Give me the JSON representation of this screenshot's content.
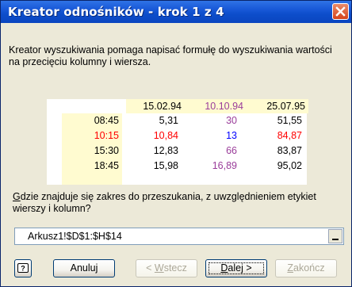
{
  "window": {
    "title": "Kreator odnośników - krok 1 z 4"
  },
  "intro_text": "Kreator wyszukiwania pomaga napisać formułę do wyszukiwania wartości na przecięciu kolumny i wiersza.",
  "preview": {
    "column_headers": [
      {
        "text": "15.02.94",
        "color": "#000000"
      },
      {
        "text": "10.10.94",
        "color": "#9a3d9a"
      },
      {
        "text": "25.07.95",
        "color": "#000000"
      }
    ],
    "rows": [
      {
        "label": "08:45",
        "label_color": "#000000",
        "values": [
          {
            "text": "5,31",
            "color": "#000000"
          },
          {
            "text": "30",
            "color": "#9a3d9a"
          },
          {
            "text": "51,55",
            "color": "#000000"
          }
        ]
      },
      {
        "label": "10:15",
        "label_color": "#ff0000",
        "values": [
          {
            "text": "10,84",
            "color": "#ff0000"
          },
          {
            "text": "13",
            "color": "#0000ff"
          },
          {
            "text": "84,87",
            "color": "#ff0000"
          }
        ]
      },
      {
        "label": "15:30",
        "label_color": "#000000",
        "values": [
          {
            "text": "12,83",
            "color": "#000000"
          },
          {
            "text": "66",
            "color": "#9a3d9a"
          },
          {
            "text": "83,87",
            "color": "#000000"
          }
        ]
      },
      {
        "label": "18:45",
        "label_color": "#000000",
        "values": [
          {
            "text": "15,98",
            "color": "#000000"
          },
          {
            "text": "16,89",
            "color": "#9a3d9a"
          },
          {
            "text": "95,02",
            "color": "#000000"
          }
        ]
      }
    ]
  },
  "question": {
    "first_letter": "G",
    "rest": "dzie znajduje się zakres do przeszukania, z uwzględnieniem etykiet wierszy i kolumn?"
  },
  "range_input": {
    "value": "Arkusz1!$D$1:$H$14"
  },
  "buttons": {
    "help": {
      "icon": "help-icon"
    },
    "cancel": {
      "label": "Anuluj"
    },
    "back": {
      "prefix": "< ",
      "accel": "W",
      "rest": "stecz"
    },
    "next": {
      "accel": "D",
      "rest": "alej >"
    },
    "finish": {
      "accel": "Z",
      "rest": "akończ"
    }
  }
}
